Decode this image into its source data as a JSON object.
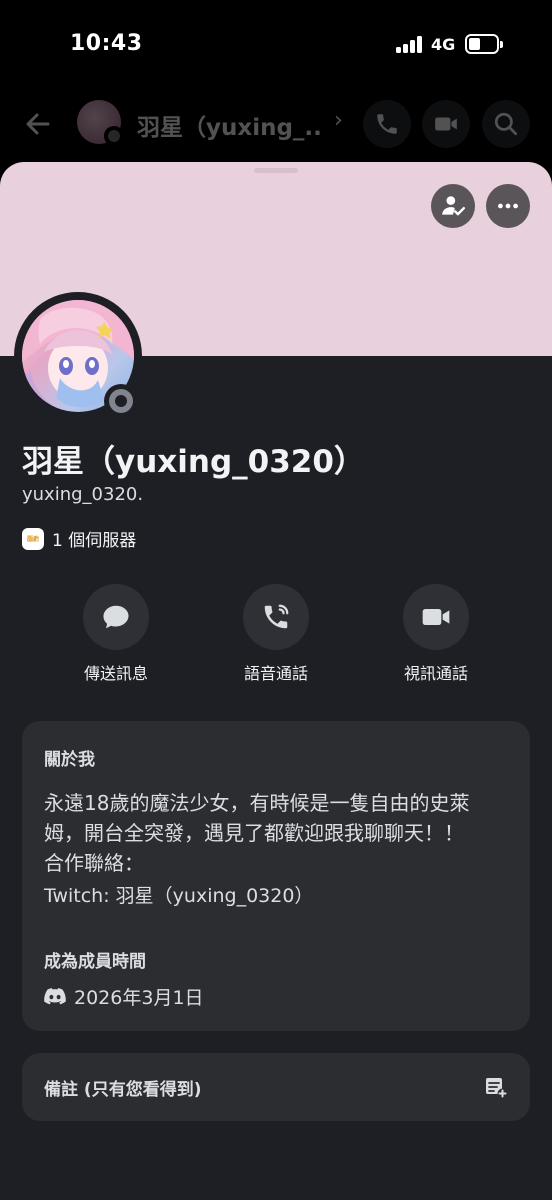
{
  "status_bar": {
    "time": "10:43",
    "network": "4G"
  },
  "header": {
    "title": "羽星（yuxing_...",
    "chevron": "›"
  },
  "icons": {
    "back": "arrow-left-icon",
    "call": "phone-icon",
    "video": "video-camera-icon",
    "search": "search-icon",
    "friend_status": "user-check-icon",
    "more": "more-dots-icon",
    "message": "chat-bubble-icon",
    "discord": "discord-logo-icon",
    "note": "note-add-icon"
  },
  "profile": {
    "display_name": "羽星（yuxing_0320）",
    "username": "yuxing_0320.",
    "mutual_servers": "1 個伺服器",
    "status": "offline"
  },
  "actions": {
    "message": "傳送訊息",
    "voice_call": "語音通話",
    "video_call": "視訊通話"
  },
  "about": {
    "title": "關於我",
    "lines": [
      "永遠18歲的魔法少女，有時候是一隻自由的史萊",
      "姆，開台全突發，遇見了都歡迎跟我聊聊天！！",
      "合作聯絡：",
      "Twitch: 羽星（yuxing_0320）"
    ]
  },
  "member_since": {
    "title": "成為成員時間",
    "date": "2026年3月1日"
  },
  "note": {
    "label": "備註 (只有您看得到)"
  },
  "colors": {
    "banner": "#e8d0dd",
    "sheet": "#1e1f24",
    "card": "#2b2d31",
    "status_offline": "#80848e"
  }
}
